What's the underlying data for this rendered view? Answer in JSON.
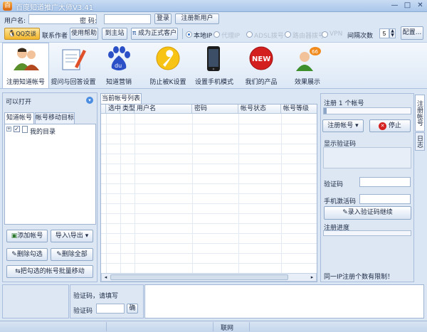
{
  "window": {
    "title": "百度知道推广大师V3.41"
  },
  "login": {
    "username_label": "用户名:",
    "username_value": "",
    "password_label": "密  码:",
    "password_value": "",
    "login_button": "登录",
    "register_button": "注册新用户"
  },
  "toolbar2": {
    "qq_label": "QQ交谈",
    "contact_author": "联系作者",
    "help": "使用帮助",
    "home": "到主站",
    "vip": "成为正式客户",
    "ip_options": [
      "本地IP",
      "代理IP",
      "ADSL拨号",
      "路由器拨号",
      "VPN"
    ],
    "interval_label": "间隔次数",
    "interval_value": "5",
    "config_button": "配置..."
  },
  "tools": [
    {
      "label": "注册知道帐号"
    },
    {
      "label": "提问与回答设置"
    },
    {
      "label": "知道营销"
    },
    {
      "label": "防止被K设置"
    },
    {
      "label": "设置手机模式"
    },
    {
      "label": "我们的产品"
    },
    {
      "label": "效果展示"
    }
  ],
  "left_panel": {
    "header": "可以打开",
    "tabs": [
      "知道帐号",
      "帐号移动目标"
    ],
    "tree_root": "我的目录",
    "buttons": {
      "add_account": "添加帐号",
      "import_export": "导入\\导出",
      "delete_checked": "删除勾选",
      "delete_all": "删除全部",
      "batch_move": "把勾选的帐号批量移动"
    }
  },
  "accounts": {
    "tab": "当前帐号列表",
    "columns": [
      "选中",
      "类型",
      "用户名",
      "密码",
      "帐号状态",
      "帐号等级"
    ]
  },
  "right_panel": {
    "register_count": "注册 1 个帐号",
    "register_button": "注册帐号",
    "stop_button": "停止",
    "show_captcha": "显示验证码",
    "captcha_label": "验证码",
    "phone_code_label": "手机激活码",
    "enter_captcha_button": "录入验证码继续",
    "progress_label": "注册进度",
    "progress_value": 0,
    "footer_note": "同一IP注册个数有限制！",
    "side_tabs": [
      "注册帐号",
      "日志"
    ]
  },
  "bottom": {
    "captcha_prompt": "验证码，请填写",
    "captcha_label": "验证码",
    "confirm_button": "确"
  },
  "statusbar": {
    "text": "联网"
  }
}
